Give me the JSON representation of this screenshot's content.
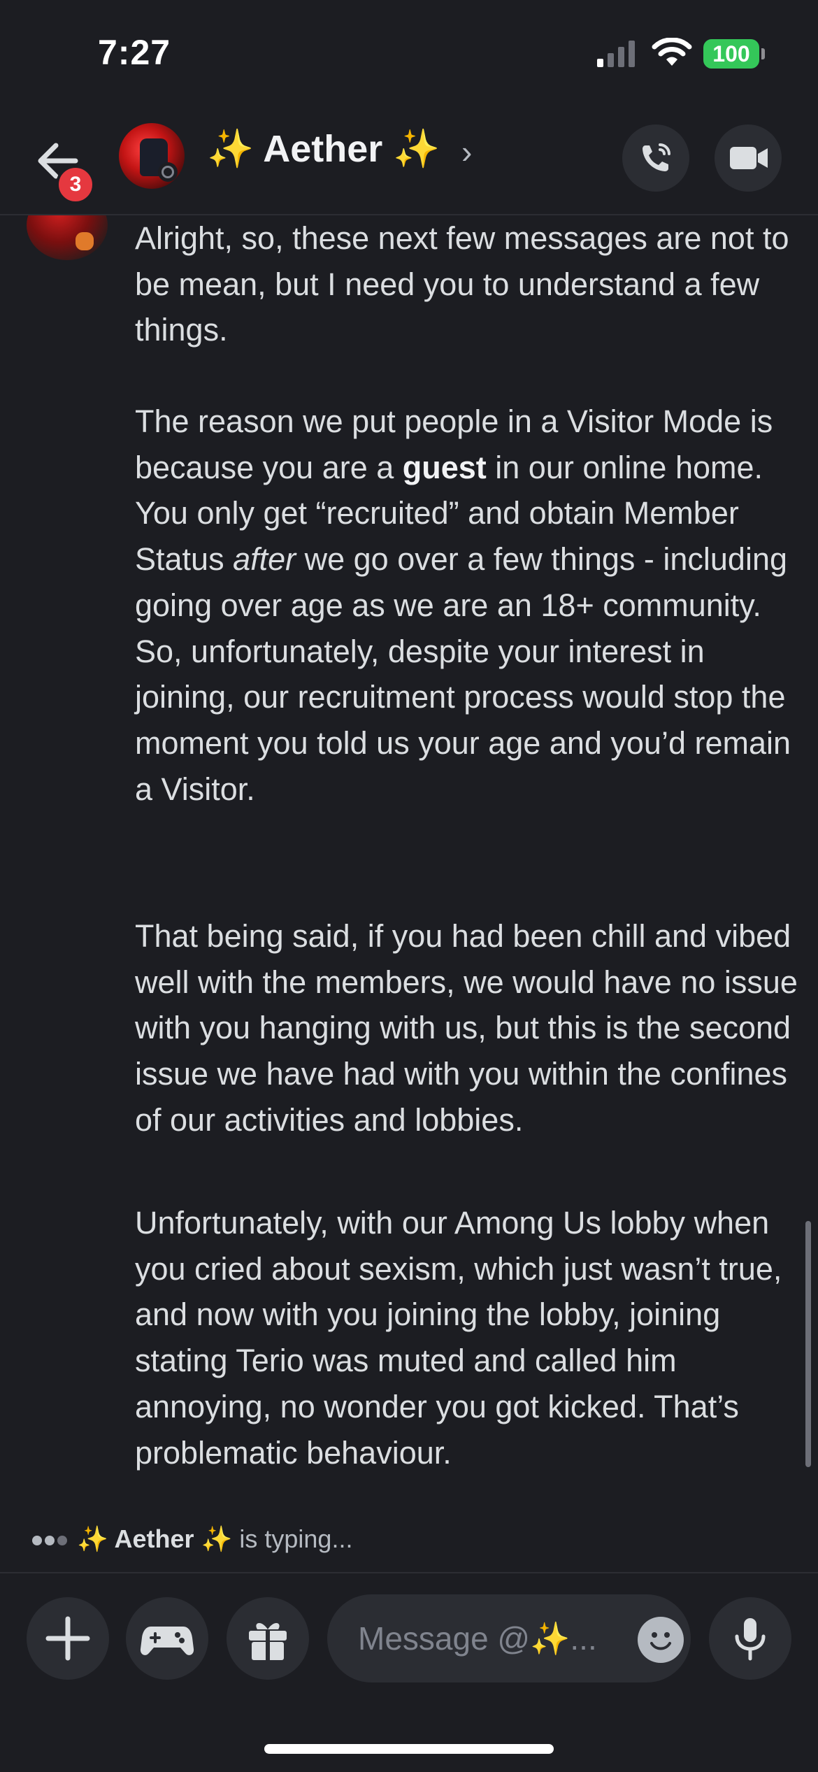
{
  "status_bar": {
    "time": "7:27",
    "battery": "100"
  },
  "header": {
    "title": "✨ Aether ✨",
    "chevron": "›",
    "unread_badge": "3"
  },
  "messages": [
    "Alright, so, these next few messages are not to be mean, but I need you to understand a few things.",
    {
      "before_bold": "The reason we put people in a Visitor Mode is because you are a ",
      "bold": "guest",
      "middle": " in our online home. You only get “recruited” and obtain Member Status ",
      "italic": "after",
      "after": " we go over a few things - including going over age as we are an 18+ community. So, unfortunately, despite your interest in joining, our recruitment process would stop the moment you told us your age and you’d remain a Visitor."
    },
    "That being said, if you had been chill and vibed well with the members, we would have no issue with you hanging with us, but this is the second issue we have had with you within the confines of our activities and lobbies.",
    "Unfortunately, with our Among Us lobby when you cried about sexism, which just wasn’t true, and now with you joining the lobby, joining stating Terio was muted and called him annoying, no wonder you got kicked. That’s problematic behaviour."
  ],
  "typing": {
    "name": "✨ Aether ✨",
    "suffix": " is typing..."
  },
  "composer": {
    "placeholder": "Message @✨..."
  },
  "icons": {
    "back": "arrow-left-icon",
    "call": "phone-icon",
    "video": "video-camera-icon",
    "plus": "plus-icon",
    "game": "gamepad-icon",
    "gift": "gift-icon",
    "emoji": "emoji-icon",
    "mic": "microphone-icon"
  },
  "colors": {
    "background": "#1c1d22",
    "badge": "#e5383f",
    "battery": "#34c759",
    "button": "#2b2d33"
  }
}
